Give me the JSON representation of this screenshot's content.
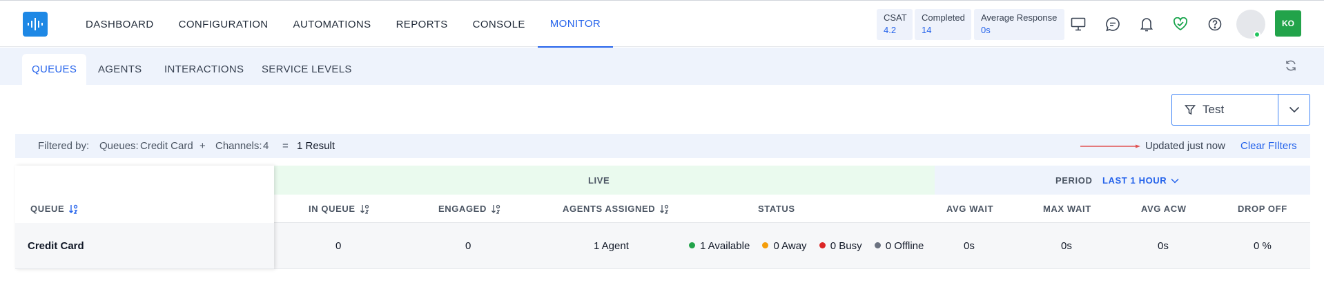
{
  "nav": {
    "items": [
      {
        "label": "DASHBOARD"
      },
      {
        "label": "CONFIGURATION"
      },
      {
        "label": "AUTOMATIONS"
      },
      {
        "label": "REPORTS"
      },
      {
        "label": "CONSOLE"
      },
      {
        "label": "MONITOR",
        "active": true
      }
    ]
  },
  "stats": {
    "csat": {
      "label": "CSAT",
      "value": "4.2"
    },
    "completed": {
      "label": "Completed",
      "value": "14"
    },
    "avg_response": {
      "label": "Average Response",
      "value": "0s"
    }
  },
  "icons": [
    "monitor-icon",
    "chat-icon",
    "bell-icon",
    "heart-icon",
    "help-icon"
  ],
  "user": {
    "initials": "KO"
  },
  "subtabs": [
    {
      "label": "QUEUES",
      "active": true
    },
    {
      "label": "AGENTS"
    },
    {
      "label": "INTERACTIONS"
    },
    {
      "label": "SERVICE LEVELS"
    }
  ],
  "filter_button": {
    "label": "Test"
  },
  "filterbar": {
    "prefix": "Filtered by:",
    "queues_label": "Queues:",
    "queues_value": "Credit Card",
    "plus": "+",
    "channels_label": "Channels:",
    "channels_value": "4",
    "equals": "=",
    "result": "1 Result",
    "updated": "Updated just now",
    "clear": "Clear FIlters"
  },
  "table": {
    "live_label": "LIVE",
    "period_label": "PERIOD",
    "period_value": "LAST 1 HOUR",
    "headers": {
      "queue": "QUEUE",
      "in_queue": "IN QUEUE",
      "engaged": "ENGAGED",
      "agents_assigned": "AGENTS ASSIGNED",
      "status": "STATUS",
      "avg_wait": "AVG WAIT",
      "max_wait": "MAX WAIT",
      "avg_acw": "AVG ACW",
      "drop_off": "DROP OFF"
    },
    "rows": [
      {
        "queue": "Credit Card",
        "in_queue": "0",
        "engaged": "0",
        "agents_assigned": "1 Agent",
        "status": {
          "available": "1 Available",
          "away": "0 Away",
          "busy": "0 Busy",
          "offline": "0 Offline"
        },
        "avg_wait": "0s",
        "max_wait": "0s",
        "avg_acw": "0s",
        "drop_off": "0 %"
      }
    ]
  },
  "colors": {
    "accent": "#2563eb",
    "available": "#22a34a",
    "away": "#f59e0b",
    "busy": "#dc2626",
    "offline": "#6b7280"
  }
}
